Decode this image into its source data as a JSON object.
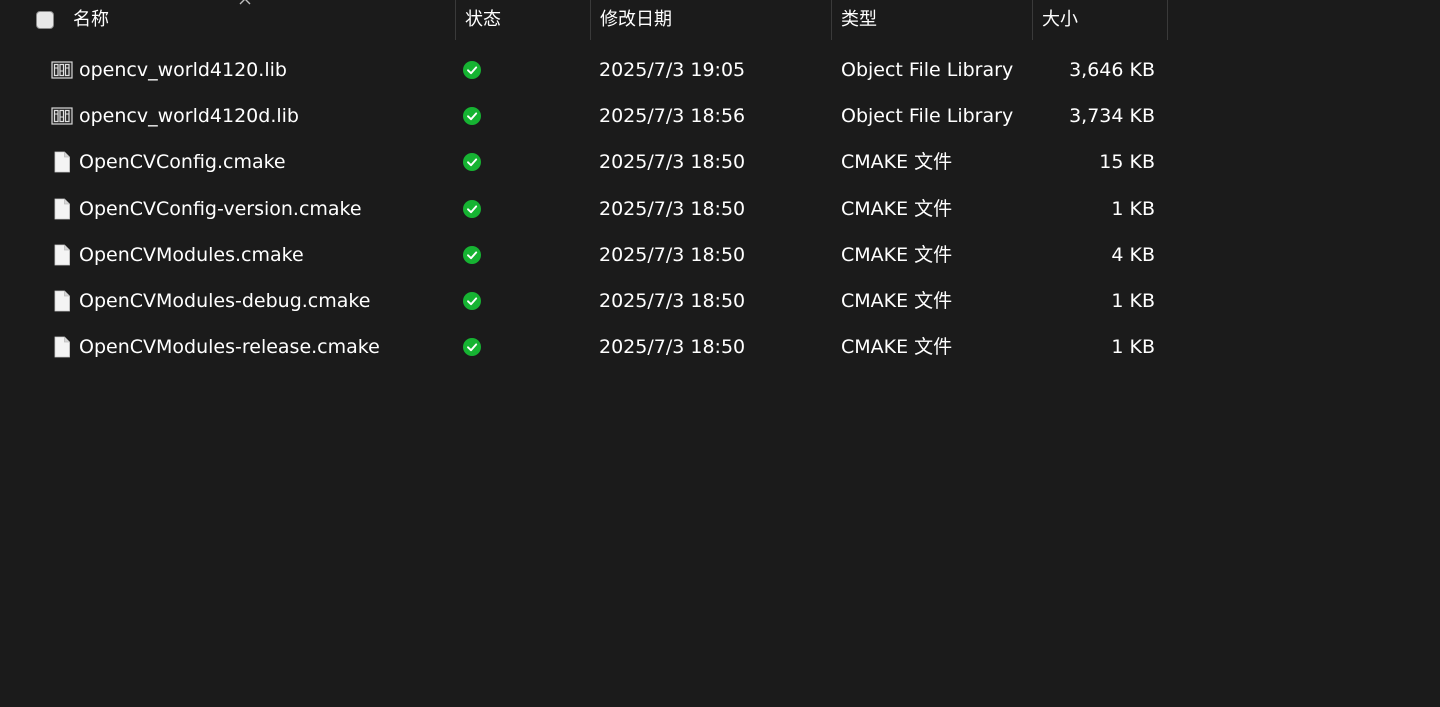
{
  "header": {
    "columns": {
      "name": "名称",
      "status": "状态",
      "date": "修改日期",
      "type": "类型",
      "size": "大小"
    }
  },
  "colors": {
    "background": "#1b1b1b",
    "text": "#ffffff",
    "status_ok": "#16b332"
  },
  "files": [
    {
      "name": "opencv_world4120.lib",
      "icon": "library-file-icon",
      "status": "synced-check-icon",
      "date": "2025/7/3 19:05",
      "type": "Object File Library",
      "size": "3,646 KB"
    },
    {
      "name": "opencv_world4120d.lib",
      "icon": "library-file-icon",
      "status": "synced-check-icon",
      "date": "2025/7/3 18:56",
      "type": "Object File Library",
      "size": "3,734 KB"
    },
    {
      "name": "OpenCVConfig.cmake",
      "icon": "blank-file-icon",
      "status": "synced-check-icon",
      "date": "2025/7/3 18:50",
      "type": "CMAKE 文件",
      "size": "15 KB"
    },
    {
      "name": "OpenCVConfig-version.cmake",
      "icon": "blank-file-icon",
      "status": "synced-check-icon",
      "date": "2025/7/3 18:50",
      "type": "CMAKE 文件",
      "size": "1 KB"
    },
    {
      "name": "OpenCVModules.cmake",
      "icon": "blank-file-icon",
      "status": "synced-check-icon",
      "date": "2025/7/3 18:50",
      "type": "CMAKE 文件",
      "size": "4 KB"
    },
    {
      "name": "OpenCVModules-debug.cmake",
      "icon": "blank-file-icon",
      "status": "synced-check-icon",
      "date": "2025/7/3 18:50",
      "type": "CMAKE 文件",
      "size": "1 KB"
    },
    {
      "name": "OpenCVModules-release.cmake",
      "icon": "blank-file-icon",
      "status": "synced-check-icon",
      "date": "2025/7/3 18:50",
      "type": "CMAKE 文件",
      "size": "1 KB"
    }
  ]
}
